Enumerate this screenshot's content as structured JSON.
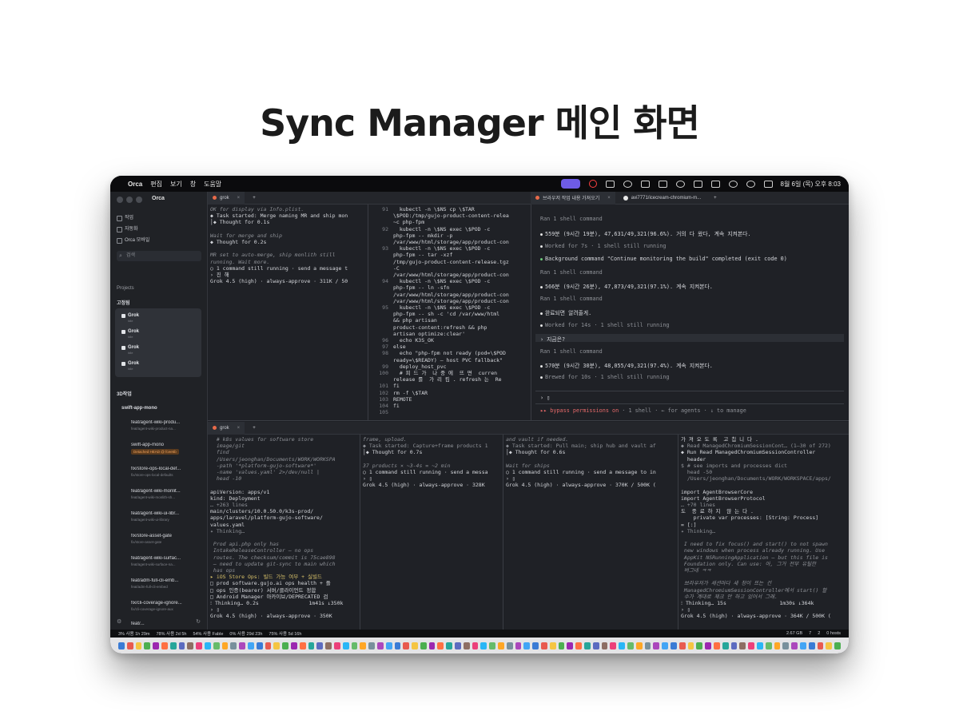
{
  "page_title": "Sync Manager 메인 화면",
  "menubar": {
    "app": "Orca",
    "menus": [
      "편집",
      "보기",
      "창",
      "도움말"
    ],
    "clock": "8월 6일 (목) 오후 8:03"
  },
  "sidebar": {
    "app_title": "Orca",
    "nav": [
      "작업",
      "자동화",
      "Orca 모바일"
    ],
    "search_placeholder": "검색",
    "projects_label": "Projects",
    "pinned_label": "고정됨",
    "grok_items": [
      {
        "name": "Grok",
        "sub": "Idle"
      },
      {
        "name": "Grok",
        "sub": "Idle"
      },
      {
        "name": "Grok",
        "sub": "Idle"
      },
      {
        "name": "Grok",
        "sub": "Idle"
      }
    ],
    "group1": "3D작업",
    "group2": "swift-app-mono",
    "worktrees": [
      {
        "name": "feat/agent-wiki-produ...",
        "sub": "feat/agent-wiki-product-na..."
      },
      {
        "name": "swift-app-mono",
        "sub": "Detached HEAD @ fcee5b"
      },
      {
        "name": "fix/store-ops-local-def...",
        "sub": "fix/store-ops-local-defaults"
      },
      {
        "name": "feat/agent-wiki-monlit...",
        "sub": "feat/agent-wiki-monlith-sh..."
      },
      {
        "name": "feat/agent-wiki-ui-libr...",
        "sub": "feat/agent-wiki-ui-library"
      },
      {
        "name": "fix/store-asset-gate",
        "sub": "fix/store-asset-gate"
      },
      {
        "name": "feat/agent-wiki-surfac...",
        "sub": "feat/agent-wiki-surface-na..."
      },
      {
        "name": "feat/adm-full-cli-emb...",
        "sub": "feat/adm-full-cli-embed"
      },
      {
        "name": "fix/cli-coverage-ignore...",
        "sub": "fix/cli-coverage-ignore-aux"
      },
      {
        "name": "feat/...",
        "sub": ""
      }
    ]
  },
  "top_tabs": {
    "left": "grok",
    "right_active": "브라우저 작업 내용 가져오기",
    "right_second": "avi7771/icecream-chromium-m..."
  },
  "bottom_tabs": {
    "left": "grok"
  },
  "pane_a": [
    {
      "t": "OK for display via Info.plist.",
      "c": "it"
    },
    {
      "t": "◆ Task started: Merge naming MR and ship mon",
      "c": ""
    },
    {
      "t": "│◆ Thought for 0.1s",
      "c": ""
    },
    {
      "t": "",
      "c": ""
    },
    {
      "t": "Wait for merge and ship",
      "c": "it"
    },
    {
      "t": "◆ Thought for 0.2s",
      "c": ""
    },
    {
      "t": "",
      "c": ""
    },
    {
      "t": "MR set to auto-merge, ship monlith still",
      "c": "it"
    },
    {
      "t": "running. Wait more.",
      "c": "it"
    },
    {
      "t": "○ 1 command still running · send a message t",
      "c": ""
    },
    {
      "t": "› 진 해",
      "c": ""
    },
    {
      "t": "Grok 4.5 (high) · always-approve · 311K / 50",
      "c": ""
    }
  ],
  "pane_b": [
    {
      "n": "91",
      "t": "  kubectl -n \\$NS cp \\$TAR"
    },
    {
      "n": "",
      "t": "\\$POD:/tmp/gujo-product-content-relea"
    },
    {
      "n": "",
      "t": "~c php-fpm"
    },
    {
      "n": "92",
      "t": "  kubectl -n \\$NS exec \\$POD -c"
    },
    {
      "n": "",
      "t": "php-fpm -- mkdir -p"
    },
    {
      "n": "",
      "t": "/var/www/html/storage/app/product-con"
    },
    {
      "n": "93",
      "t": "  kubectl -n \\$NS exec \\$POD -c"
    },
    {
      "n": "",
      "t": "php-fpm -- tar -xzf"
    },
    {
      "n": "",
      "t": "/tmp/gujo-product-content-release.tgz"
    },
    {
      "n": "",
      "t": "-C"
    },
    {
      "n": "",
      "t": "/var/www/html/storage/app/product-con"
    },
    {
      "n": "94",
      "t": "  kubectl -n \\$NS exec \\$POD -c"
    },
    {
      "n": "",
      "t": "php-fpm -- ln -sfn"
    },
    {
      "n": "",
      "t": "/var/www/html/storage/app/product-con"
    },
    {
      "n": "",
      "t": "/var/www/html/storage/app/product-con"
    },
    {
      "n": "95",
      "t": "  kubectl -n \\$NS exec \\$POD -c"
    },
    {
      "n": "",
      "t": "php-fpm -- sh -c 'cd /var/www/html"
    },
    {
      "n": "",
      "t": "&& php artisan"
    },
    {
      "n": "",
      "t": "product-content:refresh && php"
    },
    {
      "n": "",
      "t": "artisan optimize:clear'"
    },
    {
      "n": "96",
      "t": "  echo K3S_OK"
    },
    {
      "n": "97",
      "t": "else"
    },
    {
      "n": "98",
      "t": "  echo \"php-fpm not ready (pod=\\$POD"
    },
    {
      "n": "",
      "t": "ready=\\$READY) — host PVC fallback\""
    },
    {
      "n": "99",
      "t": "  deploy_host_pvc"
    },
    {
      "n": "100",
      "t": "  # 피 드 가  나 중 에  뜨 면  curren"
    },
    {
      "n": "",
      "t": "release 를  가 리 킴 . refresh 는  Re"
    },
    {
      "n": "101",
      "t": "fi"
    },
    {
      "n": "102",
      "t": "rm -f \\$TAR"
    },
    {
      "n": "103",
      "t": "REMOTE"
    },
    {
      "n": "104",
      "t": "fi"
    },
    {
      "n": "105",
      "t": ""
    }
  ],
  "chat": {
    "rows": [
      {
        "t": "Ran 1 shell command",
        "k": "dim"
      },
      {
        "t": "559분 (9시간 19분), 47,631/49,321(96.6%). 거의 다 왔다, 계속 지켜본다.",
        "k": "wb"
      },
      {
        "t": "Worked for 7s · 1 shell still running",
        "k": "dimb"
      },
      {
        "t": "Background command \"Continue monitoring the build\" completed (exit code 0)",
        "k": "gb"
      },
      {
        "t": "Ran 1 shell command",
        "k": "dim"
      },
      {
        "t": "566분 (9시간 26분), 47,873/49,321(97.1%). 계속 지켜본다.",
        "k": "wb"
      },
      {
        "t": "Ran 1 shell command",
        "k": "dim"
      },
      {
        "t": "완료되면 알려줄게.",
        "k": "wb"
      },
      {
        "t": "Worked for 14s · 1 shell still running",
        "k": "dimb"
      },
      {
        "t": "› 지금은?",
        "k": "prompt"
      },
      {
        "t": "Ran 1 shell command",
        "k": "dim"
      },
      {
        "t": "570분 (9시간 30분), 48,055/49,321(97.4%). 계속 지켜본다.",
        "k": "wb"
      },
      {
        "t": "Brewed for 10s · 1 shell still running",
        "k": "dimb"
      }
    ],
    "prompt": "› ▯",
    "mode_a": "▸▸ bypass permissions on",
    "mode_b": "· 1 shell · ← for agents · ↓ to manage"
  },
  "pane_c": [
    {
      "t": "  # k8s values for software store",
      "c": "it"
    },
    {
      "t": "  image/git",
      "c": "it"
    },
    {
      "t": "  find",
      "c": "it"
    },
    {
      "t": "  /Users/jeonghan/Documents/WORK/WORKSPA",
      "c": "it"
    },
    {
      "t": "  -path '*platform-gujo-software*'",
      "c": "it"
    },
    {
      "t": "  -name 'values.yaml' 2>/dev/null |",
      "c": "it"
    },
    {
      "t": "  head -10",
      "c": "it"
    },
    {
      "t": "",
      "c": ""
    },
    {
      "t": "apiVersion: apps/v1",
      "c": ""
    },
    {
      "t": "kind: Deployment",
      "c": ""
    },
    {
      "t": "… +263 lines",
      "c": "dim"
    },
    {
      "t": "main/clusters/10.0.50.0/k3s-prod/",
      "c": ""
    },
    {
      "t": "apps/laravel/platform-gujo-software/",
      "c": ""
    },
    {
      "t": "values.yaml",
      "c": ""
    },
    {
      "t": "✦ Thinking…",
      "c": "dim"
    },
    {
      "t": "",
      "c": ""
    },
    {
      "t": " Prod api.php only has",
      "c": "it"
    },
    {
      "t": " IntakeReleaseController — no ops",
      "c": "it"
    },
    {
      "t": " routes. The checksum/commit is 75cae898",
      "c": "it"
    },
    {
      "t": " — need to update git-sync to main which",
      "c": "it"
    },
    {
      "t": " has ops",
      "c": "it"
    },
    {
      "t": "▸ iOS Store Ops: 빌드 가능 여부 + 실빌드",
      "c": "yel"
    },
    {
      "t": "□ prod software.gujo.ai ops health + 플",
      "c": ""
    },
    {
      "t": "□ ops 인증(bearer) 서버/클라이언트 정합",
      "c": ""
    },
    {
      "t": "□ Android Manager 아카이브/DEPRECATED 검",
      "c": ""
    },
    {
      "t": "⁝ Thinking… 0.2s                1m41s ↓350k",
      "c": ""
    },
    {
      "t": "› ▯",
      "c": ""
    },
    {
      "t": "Grok 4.5 (high) · always-approve · 350K",
      "c": ""
    }
  ],
  "pane_d": [
    {
      "t": "frame, upload.",
      "c": "it"
    },
    {
      "t": "◆ Task started: Capture+frame products 1",
      "c": "dim"
    },
    {
      "t": "│◆ Thought for 0.7s",
      "c": ""
    },
    {
      "t": "",
      "c": ""
    },
    {
      "t": "37 products × ~3-4s = ~2 min",
      "c": "it"
    },
    {
      "t": "○ 1 command still running · send a messa",
      "c": ""
    },
    {
      "t": "› ▯",
      "c": ""
    },
    {
      "t": "Grok 4.5 (high) · always-approve · 328K",
      "c": ""
    }
  ],
  "pane_e": [
    {
      "t": "and vault if needed.",
      "c": "it"
    },
    {
      "t": "◆ Task started: Pull main; ship hub and vault af",
      "c": "dim"
    },
    {
      "t": "│◆ Thought for 0.6s",
      "c": ""
    },
    {
      "t": "",
      "c": ""
    },
    {
      "t": "Wait for ships",
      "c": "it"
    },
    {
      "t": "○ 1 command still running · send a message to in",
      "c": ""
    },
    {
      "t": "› ▯",
      "c": ""
    },
    {
      "t": "Grok 4.5 (high) · always-approve · 370K / 500K (",
      "c": ""
    }
  ],
  "pane_f": [
    {
      "t": "가 져 오 도 록  고 칩 니 다 .",
      "c": ""
    },
    {
      "t": "◆ Read ManagedChromiumSessionCont… (1–30 of 272)",
      "c": "dim"
    },
    {
      "t": "◆ Run Read ManagedChromiumSessionController",
      "c": ""
    },
    {
      "t": "  header",
      "c": ""
    },
    {
      "t": "$ # see imports and processes dict",
      "c": "dim"
    },
    {
      "t": "  head -50",
      "c": "dim"
    },
    {
      "t": "  /Users/jeonghan/Documents/WORK/WORKSPACE/apps/",
      "c": "dim"
    },
    {
      "t": "",
      "c": ""
    },
    {
      "t": "import AgentBrowserCore",
      "c": ""
    },
    {
      "t": "import AgentBrowserProtocol",
      "c": ""
    },
    {
      "t": "… +70 lines",
      "c": "dim"
    },
    {
      "t": "도  종 료 하 지  않 는 다 .",
      "c": ""
    },
    {
      "t": "    private var processes: [String: Process]",
      "c": ""
    },
    {
      "t": "= [:]",
      "c": ""
    },
    {
      "t": "✦ Thinking…",
      "c": "dim"
    },
    {
      "t": "",
      "c": ""
    },
    {
      "t": " I need to fix focus() and start() to not spawn",
      "c": "it"
    },
    {
      "t": " new windows when process already running. Use",
      "c": "it"
    },
    {
      "t": " AppKit NSRunningApplication — but this file is",
      "c": "it"
    },
    {
      "t": " Foundation only. Can use: 아, 그거 전부 유틸한",
      "c": "it"
    },
    {
      "t": " 버그네 ㅋㅋ",
      "c": "it"
    },
    {
      "t": "",
      "c": ""
    },
    {
      "t": " 브라우저가 세션마다 새 창이 뜨는 건",
      "c": "it"
    },
    {
      "t": " ManagedChromiumSessionController에서 start() 할",
      "c": "it"
    },
    {
      "t": " 수가 계대로 체크 안 하고 있어서 그래.",
      "c": "it"
    },
    {
      "t": "⁝ Thinking… 15s                 1m30s ↓364k",
      "c": ""
    },
    {
      "t": "› ▯",
      "c": ""
    },
    {
      "t": "Grok 4.5 (high) · always-approve · 364K / 500K (",
      "c": ""
    }
  ],
  "statusbar": {
    "items": [
      "3% 사용 1h 29m",
      "78% 사용 2d 5h",
      "54% 사용 Fable",
      "0% 사용 29d 23h",
      "75% 사용 5d 16h"
    ],
    "right": [
      "2.67 GB",
      "7",
      "2",
      "0 hosts"
    ]
  },
  "colors": {
    "accent": "#6e5ce6",
    "bg": "#1f2126",
    "prompt_mode": "#e86a6a",
    "success": "#6fcf7d"
  }
}
